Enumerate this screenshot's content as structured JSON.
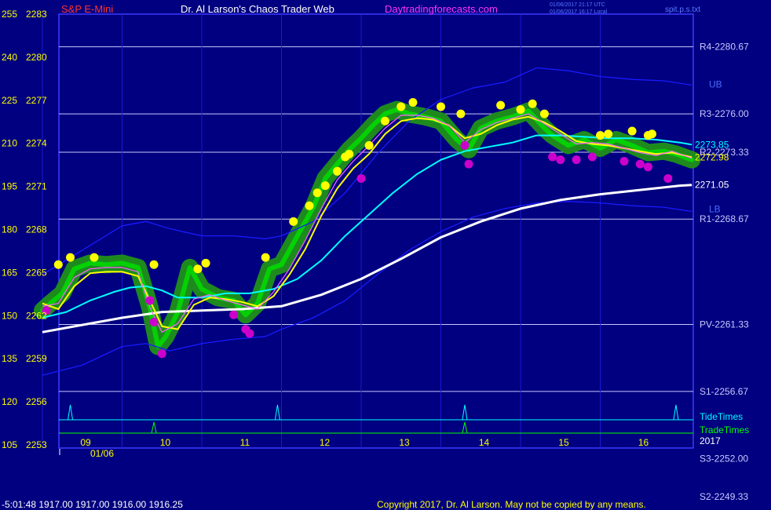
{
  "header": {
    "symbol": "S&P E-Mini",
    "title": "Dr. Al Larson's Chaos Trader Web",
    "site": "Daytradingforecasts.com",
    "timestamp_utc": "01/06/2017 21:17 UTC",
    "timestamp_local": "01/06/2017 16:17 Local",
    "filename": "spit.p.s.txt"
  },
  "footer": {
    "quote": "-5:01:48 1917.00 1917.00 1916.00 1916.25",
    "copyright": "Copyright 2017, Dr. Al Larson. May not be copied by any means."
  },
  "colors": {
    "background": "#000080",
    "frame": "#3a3aff",
    "price": "#00dd00",
    "price_halo": "#1e8a1e",
    "fast_ma": "#ffff00",
    "mid_ma": "#ff66ff",
    "slow_ma": "#00ffff",
    "vwap": "#ffffff",
    "bands": "#1a1aff",
    "pivot_levels": "#c8c8ff",
    "tide": "#00ffff",
    "trade": "#00ff00",
    "high_dot": "#ffff00",
    "low_dot": "#cc00cc",
    "symbol_text": "#ff3333",
    "site_text": "#ff33ff"
  },
  "chart_data": {
    "type": "line",
    "yaxis": {
      "price_ticks": [
        2283,
        2280,
        2277,
        2274,
        2271,
        2268,
        2265,
        2262,
        2259,
        2256,
        2253
      ],
      "index_ticks": [
        255,
        240,
        225,
        210,
        195,
        180,
        165,
        150,
        135,
        120,
        105
      ],
      "ylim": [
        2253,
        2283
      ]
    },
    "xaxis": {
      "hour_ticks": [
        "09",
        "10",
        "11",
        "12",
        "13",
        "14",
        "15",
        "16"
      ],
      "date_label": "01/06",
      "xlim": [
        8.0,
        16.15
      ]
    },
    "levels": [
      {
        "label": "R4-2280.67",
        "value": 2280.67
      },
      {
        "label": "R3-2276.00",
        "value": 2276.0
      },
      {
        "label": "R2-2273.33",
        "value": 2273.33
      },
      {
        "label": "R1-2268.67",
        "value": 2268.67
      },
      {
        "label": "PV-2261.33",
        "value": 2261.33
      },
      {
        "label": "S1-2256.67",
        "value": 2256.67
      },
      {
        "label": "S3-2252.00",
        "value": 2252.0
      },
      {
        "label": "S2-2249.33",
        "value": 2249.33
      }
    ],
    "band_labels": {
      "upper": "UB",
      "lower": "LB"
    },
    "price_labels": [
      {
        "text": "2273.85",
        "value": 2273.85
      },
      {
        "text": "2272.98",
        "value": 2272.98
      },
      {
        "text": "2271.05",
        "value": 2271.05
      }
    ],
    "timing_labels": {
      "tide": "TideTimes",
      "trade": "TradeTimes",
      "year": "2017"
    },
    "tide_times": [
      8.35,
      10.95,
      13.3,
      15.95
    ],
    "trade_times": [
      9.4,
      13.3
    ],
    "series": [
      {
        "key": "price",
        "x": [
          8.0,
          8.1,
          8.25,
          8.4,
          8.6,
          8.8,
          9.0,
          9.2,
          9.35,
          9.45,
          9.55,
          9.7,
          9.85,
          10.0,
          10.2,
          10.4,
          10.55,
          10.7,
          10.85,
          11.0,
          11.2,
          11.4,
          11.55,
          11.7,
          11.85,
          12.0,
          12.15,
          12.3,
          12.45,
          12.6,
          12.8,
          13.0,
          13.2,
          13.35,
          13.5,
          13.7,
          13.9,
          14.1,
          14.2,
          14.3,
          14.4,
          14.6,
          14.8,
          15.0,
          15.2,
          15.4,
          15.6,
          15.8,
          15.95,
          16.15
        ],
        "values": [
          2262.3,
          2262.8,
          2263.5,
          2265.2,
          2265.6,
          2265.5,
          2265.6,
          2265.3,
          2262.5,
          2259.8,
          2260.5,
          2262.2,
          2265.3,
          2263.8,
          2263.2,
          2263.0,
          2262.0,
          2262.8,
          2265.2,
          2265.5,
          2267.5,
          2269.5,
          2271.5,
          2272.5,
          2273.5,
          2274.3,
          2275.2,
          2276.0,
          2276.3,
          2276.0,
          2275.8,
          2275.5,
          2274.2,
          2273.5,
          2275.0,
          2275.5,
          2275.8,
          2276.2,
          2275.6,
          2275.0,
          2274.5,
          2273.8,
          2274.2,
          2273.6,
          2274.2,
          2273.8,
          2273.3,
          2273.4,
          2273.2,
          2272.8
        ]
      },
      {
        "key": "fast_ma",
        "x": [
          8.0,
          8.2,
          8.4,
          8.6,
          8.8,
          9.0,
          9.2,
          9.35,
          9.5,
          9.7,
          9.9,
          10.1,
          10.3,
          10.5,
          10.7,
          10.9,
          11.1,
          11.3,
          11.5,
          11.7,
          11.9,
          12.1,
          12.3,
          12.5,
          12.7,
          12.9,
          13.1,
          13.3,
          13.5,
          13.7,
          13.9,
          14.1,
          14.3,
          14.5,
          14.7,
          14.9,
          15.1,
          15.3,
          15.5,
          15.7,
          15.9,
          16.15
        ],
        "values": [
          2262.8,
          2262.4,
          2264.0,
          2264.9,
          2265.0,
          2265.0,
          2264.7,
          2263.0,
          2261.2,
          2261.0,
          2262.7,
          2263.2,
          2263.1,
          2262.9,
          2262.6,
          2263.3,
          2264.8,
          2266.6,
          2268.9,
          2270.8,
          2272.2,
          2273.2,
          2274.6,
          2275.5,
          2275.7,
          2275.6,
          2275.2,
          2274.3,
          2274.6,
          2275.2,
          2275.6,
          2275.8,
          2275.4,
          2274.8,
          2274.1,
          2273.9,
          2273.8,
          2273.6,
          2273.4,
          2273.2,
          2273.3,
          2272.98
        ]
      },
      {
        "key": "mid_ma",
        "x": [
          8.0,
          8.2,
          8.4,
          8.6,
          8.8,
          9.0,
          9.2,
          9.35,
          9.5,
          9.7,
          9.9,
          10.1,
          10.3,
          10.5,
          10.7,
          10.9,
          11.1,
          11.3,
          11.5,
          11.7,
          11.9,
          12.1,
          12.3,
          12.5,
          12.7,
          12.9,
          13.1,
          13.3,
          13.5,
          13.7,
          13.9,
          14.1,
          14.3,
          14.5,
          14.7,
          14.9,
          15.1,
          15.3,
          15.5,
          15.7,
          15.9,
          16.15
        ],
        "values": [
          2262.6,
          2262.8,
          2264.6,
          2265.2,
          2265.3,
          2265.3,
          2265.0,
          2262.5,
          2260.8,
          2261.4,
          2263.1,
          2263.4,
          2263.0,
          2262.7,
          2262.4,
          2263.6,
          2265.2,
          2267.2,
          2269.4,
          2271.4,
          2272.7,
          2273.8,
          2275.0,
          2275.9,
          2275.9,
          2275.7,
          2275.2,
          2274.0,
          2274.9,
          2275.4,
          2275.7,
          2276.0,
          2275.3,
          2274.6,
          2273.9,
          2274.0,
          2273.9,
          2273.6,
          2273.3,
          2273.1,
          2273.4,
          2272.9
        ]
      },
      {
        "key": "slow_ma",
        "x": [
          8.0,
          8.3,
          8.6,
          8.9,
          9.1,
          9.3,
          9.5,
          9.7,
          10.0,
          10.3,
          10.6,
          10.9,
          11.2,
          11.5,
          11.8,
          12.1,
          12.4,
          12.7,
          13.0,
          13.3,
          13.6,
          13.9,
          14.2,
          14.5,
          14.8,
          15.1,
          15.4,
          15.7,
          16.0,
          16.15
        ],
        "values": [
          2261.8,
          2262.2,
          2263.0,
          2263.6,
          2263.9,
          2264.0,
          2263.7,
          2263.2,
          2263.2,
          2263.5,
          2263.5,
          2263.8,
          2264.5,
          2265.8,
          2267.5,
          2269.0,
          2270.5,
          2271.8,
          2272.8,
          2273.4,
          2273.7,
          2274.0,
          2274.5,
          2274.5,
          2274.4,
          2274.3,
          2274.3,
          2274.2,
          2274.0,
          2273.85
        ]
      },
      {
        "key": "vwap",
        "x": [
          8.0,
          8.5,
          9.0,
          9.5,
          10.0,
          10.5,
          11.0,
          11.5,
          12.0,
          12.5,
          13.0,
          13.5,
          14.0,
          14.5,
          15.0,
          15.5,
          16.0,
          16.15
        ],
        "values": [
          2260.8,
          2261.3,
          2261.8,
          2262.2,
          2262.3,
          2262.4,
          2262.6,
          2263.4,
          2264.5,
          2265.9,
          2267.4,
          2268.5,
          2269.4,
          2270.0,
          2270.4,
          2270.7,
          2271.0,
          2271.05
        ]
      },
      {
        "key": "upper_band",
        "x": [
          8.0,
          8.5,
          9.0,
          9.3,
          9.6,
          10.0,
          10.4,
          10.8,
          11.0,
          11.4,
          11.8,
          12.2,
          12.6,
          13.0,
          13.4,
          13.8,
          14.2,
          14.6,
          15.0,
          15.4,
          15.8,
          16.15
        ],
        "values": [
          2264.8,
          2266.5,
          2268.2,
          2268.5,
          2268.0,
          2267.5,
          2267.5,
          2267.3,
          2267.5,
          2268.5,
          2270.5,
          2273.2,
          2275.5,
          2277.0,
          2277.8,
          2278.2,
          2279.2,
          2279.0,
          2278.6,
          2278.4,
          2278.3,
          2278.0
        ]
      },
      {
        "key": "lower_band",
        "x": [
          8.0,
          8.5,
          9.0,
          9.3,
          9.6,
          10.0,
          10.4,
          10.8,
          11.0,
          11.4,
          11.8,
          12.2,
          12.6,
          13.0,
          13.4,
          13.8,
          14.2,
          14.6,
          15.0,
          15.4,
          15.8,
          16.15
        ],
        "values": [
          2257.8,
          2258.5,
          2259.8,
          2260.0,
          2259.5,
          2260.0,
          2260.3,
          2260.5,
          2261.0,
          2261.8,
          2263.0,
          2264.8,
          2266.5,
          2267.8,
          2268.8,
          2269.4,
          2269.8,
          2269.9,
          2269.8,
          2269.6,
          2269.5,
          2269.2
        ]
      }
    ],
    "high_dots": {
      "x": [
        8.2,
        8.35,
        8.65,
        9.4,
        9.95,
        10.05,
        10.8,
        11.15,
        11.35,
        11.45,
        11.55,
        11.7,
        11.8,
        11.85,
        12.1,
        12.3,
        12.5,
        12.65,
        13.0,
        13.25,
        13.75,
        14.0,
        14.15,
        14.3,
        15.0,
        15.1,
        15.4,
        15.6,
        15.65
      ],
      "values": [
        2265.5,
        2266.0,
        2266.0,
        2265.5,
        2265.2,
        2265.6,
        2266.0,
        2268.5,
        2269.6,
        2270.5,
        2271.0,
        2272.0,
        2273.0,
        2273.2,
        2273.8,
        2275.5,
        2276.5,
        2276.8,
        2276.5,
        2276.0,
        2276.6,
        2276.3,
        2276.7,
        2276.0,
        2274.5,
        2274.6,
        2274.8,
        2274.5,
        2274.6
      ]
    },
    "low_dots": {
      "x": [
        8.05,
        9.35,
        9.4,
        9.5,
        10.4,
        10.55,
        10.6,
        12.0,
        13.3,
        13.35,
        14.4,
        14.5,
        14.7,
        14.9,
        15.3,
        15.5,
        15.6,
        15.85
      ],
      "values": [
        2262.3,
        2263.0,
        2261.5,
        2259.3,
        2262.0,
        2261.0,
        2260.7,
        2271.5,
        2273.8,
        2272.5,
        2273.0,
        2272.8,
        2272.8,
        2273.0,
        2272.7,
        2272.5,
        2272.3,
        2271.5
      ]
    }
  }
}
